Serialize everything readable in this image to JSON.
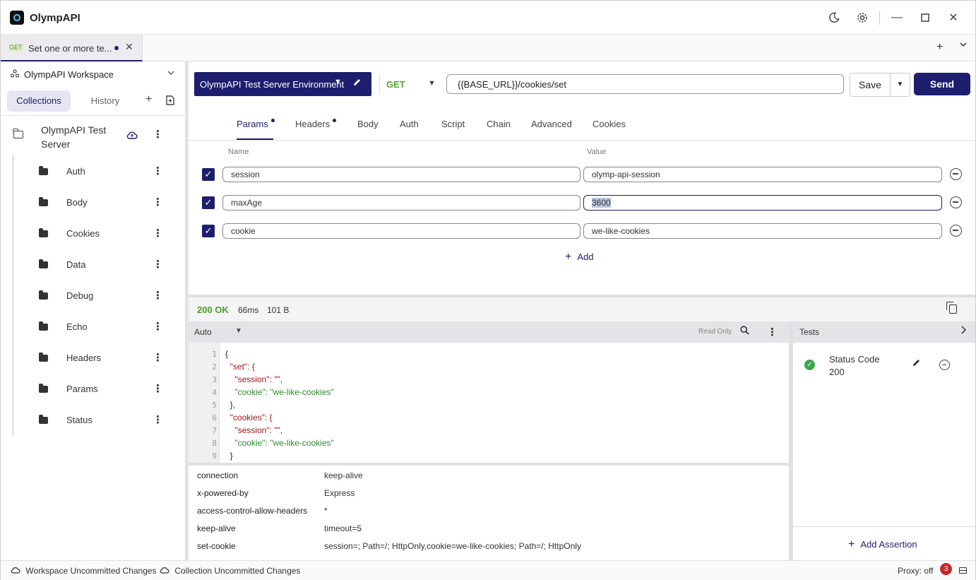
{
  "app": {
    "title": "OlympAPI"
  },
  "window_controls": {
    "theme_icon": "moon-icon",
    "settings_icon": "gear-icon",
    "minimize": "—",
    "maximize": "☐",
    "close": "✕"
  },
  "tabs": [
    {
      "method": "GET",
      "label": "Set one or more te...",
      "unsaved": true,
      "close": "✕"
    }
  ],
  "tabstrip": {
    "add": "+",
    "more": "⌄"
  },
  "workspace": {
    "name": "OlympAPI Workspace"
  },
  "sidebar": {
    "segments": [
      "Collections",
      "History"
    ],
    "collection": {
      "name": "OlympAPI Test Server"
    },
    "folders": [
      "Auth",
      "Body",
      "Cookies",
      "Data",
      "Debug",
      "Echo",
      "Headers",
      "Params",
      "Status"
    ]
  },
  "request": {
    "environment": "OlympAPI Test Server Environment",
    "method": "GET",
    "url": "{{BASE_URL}}/cookies/set",
    "save_label": "Save",
    "send_label": "Send"
  },
  "request_tabs": [
    {
      "label": "Params",
      "dot": true
    },
    {
      "label": "Headers",
      "dot": true
    },
    {
      "label": "Body"
    },
    {
      "label": "Auth"
    },
    {
      "label": "Script"
    },
    {
      "label": "Chain"
    },
    {
      "label": "Advanced"
    },
    {
      "label": "Cookies"
    }
  ],
  "params": {
    "name_header": "Name",
    "value_header": "Value",
    "rows": [
      {
        "name": "session",
        "value": "olymp-api-session",
        "enabled": true
      },
      {
        "name": "maxAge",
        "value": "3600",
        "enabled": true
      },
      {
        "name": "cookie",
        "value": "we-like-cookies",
        "enabled": true
      }
    ],
    "add_label": "Add"
  },
  "response": {
    "status": "200 OK",
    "time": "66ms",
    "size": "101 B",
    "format": "Auto",
    "readonly_label": "Read Only",
    "body_lines": [
      {
        "n": "1",
        "t": "{"
      },
      {
        "n": "2",
        "t": "  \"set\": {"
      },
      {
        "n": "3",
        "t": "    \"session\": \"\","
      },
      {
        "n": "4",
        "t": "    \"cookie\": \"we-like-cookies\""
      },
      {
        "n": "5",
        "t": "  },"
      },
      {
        "n": "6",
        "t": "  \"cookies\": {"
      },
      {
        "n": "7",
        "t": "    \"session\": \"\","
      },
      {
        "n": "8",
        "t": "    \"cookie\": \"we-like-cookies\""
      },
      {
        "n": "9",
        "t": "  }"
      }
    ],
    "headers": [
      {
        "key": "connection",
        "value": "keep-alive"
      },
      {
        "key": "x-powered-by",
        "value": "Express"
      },
      {
        "key": "access-control-allow-headers",
        "value": "*"
      },
      {
        "key": "keep-alive",
        "value": "timeout=5"
      },
      {
        "key": "set-cookie",
        "value": "session=; Path=/; HttpOnly,cookie=we-like-cookies; Path=/; HttpOnly"
      }
    ]
  },
  "tests": {
    "title": "Tests",
    "assertion": {
      "line1": "Status Code",
      "line2": "200"
    },
    "add_label": "Add Assertion"
  },
  "statusbar": {
    "workspace_changes": "Workspace Uncommitted Changes",
    "collection_changes": "Collection Uncommitted Changes",
    "proxy": "Proxy: off",
    "notifications": "3"
  }
}
